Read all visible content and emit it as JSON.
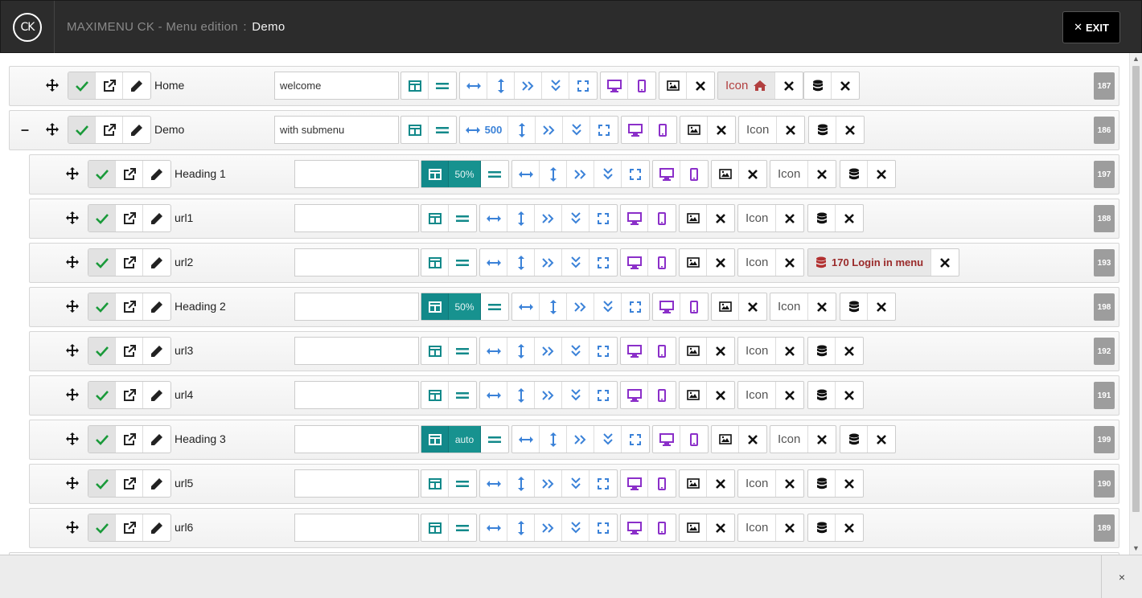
{
  "header": {
    "app_name": "MAXIMENU CK - Menu edition",
    "separator": ":",
    "page_name": "Demo",
    "logo_text": "CK",
    "exit_label": "EXIT"
  },
  "colors": {
    "header_bg": "#2c2c2c",
    "teal": "#12898a",
    "blue_icon": "#3b82d8",
    "purple_icon": "#8b2fc9",
    "green_check": "#1a9a3a",
    "red_home": "#b24040"
  },
  "icon_label": "Icon",
  "items": [
    {
      "id": "187",
      "title": "Home",
      "level": 0,
      "css_class": "welcome",
      "width_value": "",
      "column_value": "",
      "icon_type": "home",
      "extra": ""
    },
    {
      "id": "186",
      "title": "Demo",
      "level": 0,
      "collapse": "–",
      "css_class": "with submenu",
      "width_value": "500",
      "column_value": "",
      "icon_type": "",
      "extra": ""
    },
    {
      "id": "197",
      "title": "Heading 1",
      "level": 1,
      "css_class": "",
      "width_value": "",
      "column_value": "50%",
      "icon_type": "",
      "extra": ""
    },
    {
      "id": "188",
      "title": "url1",
      "level": 1,
      "css_class": "",
      "width_value": "",
      "column_value": "",
      "icon_type": "",
      "extra": ""
    },
    {
      "id": "193",
      "title": "url2",
      "level": 1,
      "css_class": "",
      "width_value": "",
      "column_value": "",
      "icon_type": "",
      "extra": "170 Login in menu"
    },
    {
      "id": "198",
      "title": "Heading 2",
      "level": 1,
      "css_class": "",
      "width_value": "",
      "column_value": "50%",
      "icon_type": "",
      "extra": ""
    },
    {
      "id": "192",
      "title": "url3",
      "level": 1,
      "css_class": "",
      "width_value": "",
      "column_value": "",
      "icon_type": "",
      "extra": ""
    },
    {
      "id": "191",
      "title": "url4",
      "level": 1,
      "css_class": "",
      "width_value": "",
      "column_value": "",
      "icon_type": "",
      "extra": ""
    },
    {
      "id": "199",
      "title": "Heading 3",
      "level": 1,
      "css_class": "",
      "width_value": "",
      "column_value": "auto",
      "icon_type": "",
      "extra": ""
    },
    {
      "id": "190",
      "title": "url5",
      "level": 1,
      "css_class": "",
      "width_value": "",
      "column_value": "",
      "icon_type": "",
      "extra": ""
    },
    {
      "id": "189",
      "title": "url6",
      "level": 1,
      "css_class": "",
      "width_value": "",
      "column_value": "",
      "icon_type": "",
      "extra": ""
    }
  ],
  "footer": {
    "close_symbol": "×"
  }
}
